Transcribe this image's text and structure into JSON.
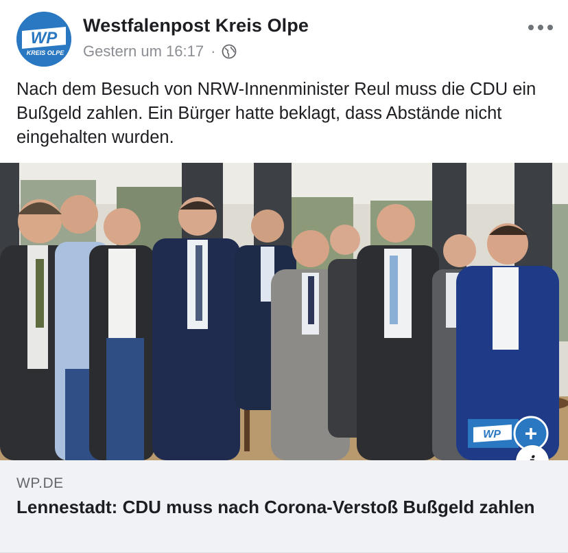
{
  "post": {
    "page_name": "Westfalenpost Kreis Olpe",
    "avatar": {
      "logo_text": "WP",
      "logo_subtext": "KREIS OLPE",
      "color": "#2a78c2"
    },
    "timestamp": "Gestern um 16:17",
    "separator": "·",
    "privacy_icon": "globe-icon",
    "more_icon": "more-options-icon",
    "text": "Nach dem Besuch von NRW-Innenminister Reul muss die CDU ein Bußgeld zahlen. Ein Bürger hatte beklagt, dass Abstände nicht eingehalten wurden."
  },
  "image": {
    "description_icon": "photo-of-group",
    "overlay_badge": {
      "logo": "WP",
      "plus": "+"
    },
    "info_label": "i"
  },
  "link_preview": {
    "domain": "WP.DE",
    "title": "Lennestadt: CDU muss nach Corona-Verstoß Bußgeld zahlen"
  }
}
